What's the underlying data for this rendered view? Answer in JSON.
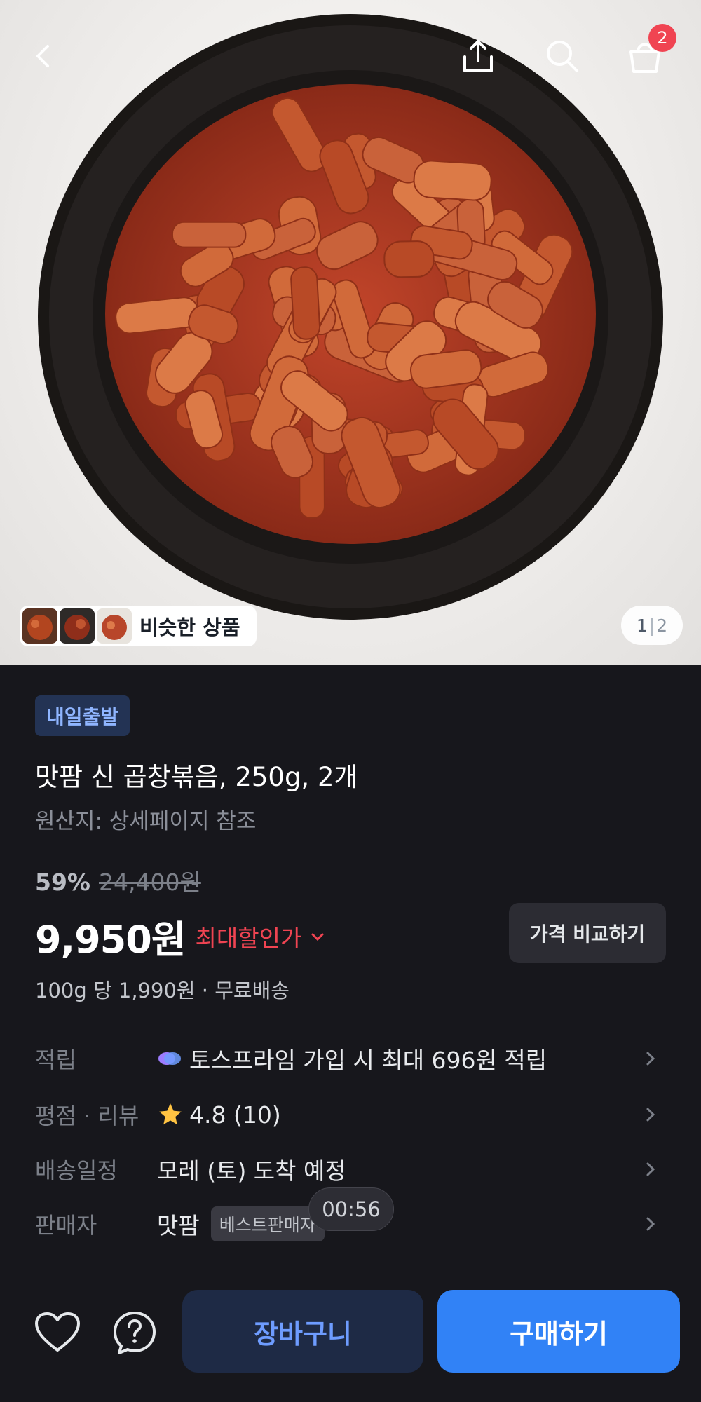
{
  "header": {
    "icons": [
      "back-icon",
      "share-icon",
      "search-icon",
      "cart-icon"
    ],
    "cart_badge": "2"
  },
  "gallery": {
    "similar_label": "비슷한 상품",
    "current_page": "1",
    "separator": "|",
    "total_pages": "2"
  },
  "product": {
    "tag": "내일출발",
    "title": "맛팜 신 곱창볶음, 250g, 2개",
    "origin": "원산지: 상세페이지 참조",
    "discount_rate": "59%",
    "original_price": "24,400원",
    "price": "9,950원",
    "max_discount_label": "최대할인가",
    "compare_button": "가격 비교하기",
    "unit_price": "100g 당 1,990원 · 무료배송"
  },
  "info_rows": [
    {
      "key": "적립",
      "value": "토스프라임 가입 시 최대 696원 적립",
      "icon": "prime-icon"
    },
    {
      "key": "평점 · 리뷰",
      "value": "4.8 (10)",
      "icon": "star-icon"
    },
    {
      "key": "배송일정",
      "value": "모레 (토) 도착 예정"
    },
    {
      "key": "판매자",
      "value": "맛팜",
      "badge": "베스트판매자"
    }
  ],
  "timer": "00:56",
  "bottom_bar": {
    "cart_button": "장바구니",
    "buy_button": "구매하기",
    "icons": [
      "heart-icon",
      "help-icon"
    ]
  },
  "colors": {
    "background": "#17171c",
    "accent_blue": "#3182f6",
    "discount_red": "#f04452",
    "tag_bg": "#233354"
  }
}
